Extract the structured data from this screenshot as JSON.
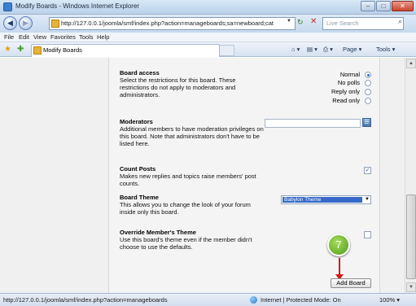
{
  "window": {
    "title": "Modify Boards - Windows Internet Explorer",
    "minimize": "–",
    "maximize": "□",
    "close": "✕"
  },
  "address_bar": {
    "back": "◀",
    "forward": "▶",
    "url": "http://127.0.0.1/joomla/smf/index.php?action=manageboards;sa=newboard;cat",
    "dropdown": "▼",
    "refresh": "↻",
    "stop": "✕",
    "search_placeholder": "Live Search",
    "search_icon": "⌕"
  },
  "menu": [
    "File",
    "Edit",
    "View",
    "Favorites",
    "Tools",
    "Help"
  ],
  "command_bar": {
    "favorites_icon": "★",
    "add_favorite_icon": "✚",
    "tab_title": "Modify Boards",
    "home": "⌂ ▾",
    "feeds": "▤ ▾",
    "print": "⎙ ▾",
    "page": "Page ▾",
    "tools": "Tools ▾"
  },
  "form": {
    "board_access": {
      "title": "Board access",
      "description": "Select the restrictions for this board. These restrictions do not apply to moderators and administrators.",
      "options": [
        {
          "label": "Normal",
          "checked": true
        },
        {
          "label": "No polls",
          "checked": false
        },
        {
          "label": "Reply only",
          "checked": false
        },
        {
          "label": "Read only",
          "checked": false
        }
      ]
    },
    "moderators": {
      "title": "Moderators",
      "description": "Additional members to have moderation privileges on this board. Note that administrators don't have to be listed here.",
      "value": "",
      "button_icon": "☰"
    },
    "count_posts": {
      "title": "Count Posts",
      "description": "Makes new replies and topics raise members' post counts.",
      "checked": true,
      "check_mark": "✓"
    },
    "board_theme": {
      "title": "Board Theme",
      "description": "This allows you to change the look of your forum inside only this board.",
      "selected": "Babylon Theme",
      "arrow": "▼"
    },
    "override_theme": {
      "title": "Override Member's Theme",
      "description": "Use this board's theme even if the member didn't choose to use the defaults.",
      "checked": false
    },
    "add_button": "Add Board"
  },
  "callout": {
    "number": "7",
    "accent": "#d11b1b",
    "badge_color": "#4f9c1c"
  },
  "scrollbar": {
    "up": "▲",
    "down": "▼"
  },
  "status_bar": {
    "url": "http://127.0.0.1/joomla/smf/index.php?action=manageboards",
    "zone": "Internet | Protected Mode: On",
    "zoom": "100%",
    "zoom_dropdown": "▾"
  }
}
